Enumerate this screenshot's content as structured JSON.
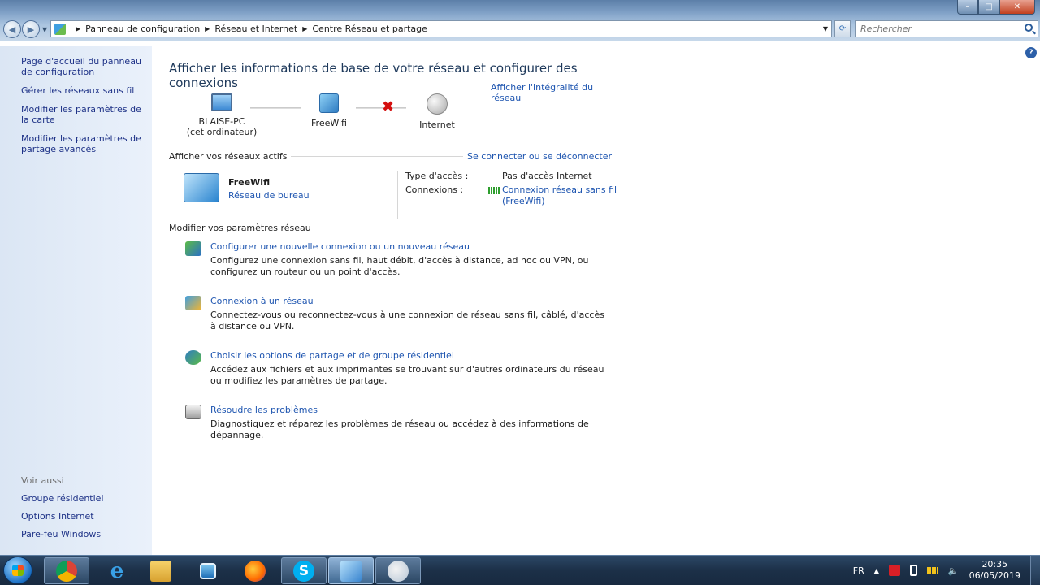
{
  "window": {
    "breadcrumbs": [
      "Panneau de configuration",
      "Réseau et Internet",
      "Centre Réseau et partage"
    ],
    "search_placeholder": "Rechercher",
    "min_label": "–",
    "max_label": "□",
    "close_label": "✕"
  },
  "sidebar": {
    "links": [
      "Page d'accueil du panneau de configuration",
      "Gérer les réseaux sans fil",
      "Modifier les paramètres de la carte",
      "Modifier les paramètres de partage avancés"
    ],
    "see_also_label": "Voir aussi",
    "see_also": [
      "Groupe résidentiel",
      "Options Internet",
      "Pare-feu Windows"
    ]
  },
  "main": {
    "title": "Afficher les informations de base de votre réseau et configurer des connexions",
    "map_link": "Afficher l'intégralité du réseau",
    "nodes": {
      "pc_name": "BLAISE-PC",
      "pc_sub": "(cet ordinateur)",
      "wifi": "FreeWifi",
      "internet": "Internet"
    },
    "active_header": "Afficher vos réseaux actifs",
    "connect_link": "Se connecter ou se déconnecter",
    "active_network": {
      "name": "FreeWifi",
      "type": "Réseau de bureau",
      "access_label": "Type d'accès :",
      "access_value": "Pas d'accès Internet",
      "connections_label": "Connexions :",
      "connections_value": "Connexion réseau sans fil (FreeWifi)"
    },
    "settings_header": "Modifier vos paramètres réseau",
    "tasks": [
      {
        "title": "Configurer une nouvelle connexion ou un nouveau réseau",
        "desc": "Configurez une connexion sans fil, haut débit, d'accès à distance, ad hoc ou VPN, ou configurez un routeur ou un point d'accès."
      },
      {
        "title": "Connexion à un réseau",
        "desc": "Connectez-vous ou reconnectez-vous à une connexion de réseau sans fil, câblé, d'accès à distance ou VPN."
      },
      {
        "title": "Choisir les options de partage et de groupe résidentiel",
        "desc": "Accédez aux fichiers et aux imprimantes se trouvant sur d'autres ordinateurs du réseau ou modifiez les paramètres de partage."
      },
      {
        "title": "Résoudre les problèmes",
        "desc": "Diagnostiquez et réparez les problèmes de réseau ou accédez à des informations de dépannage."
      }
    ]
  },
  "taskbar": {
    "skype_letter": "S",
    "ie_letter": "e",
    "lang": "FR",
    "time": "20:35",
    "date": "06/05/2019"
  }
}
